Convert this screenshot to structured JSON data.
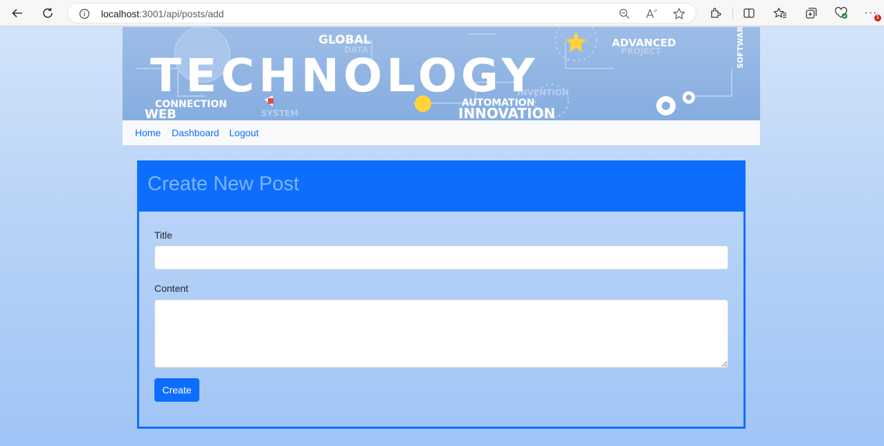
{
  "browser": {
    "url_host": "localhost",
    "url_rest": ":3001/api/posts/add",
    "notification_count": "1"
  },
  "banner": {
    "title": "TECHNOLOGY",
    "words": {
      "global": "GLOBAL",
      "advanced": "ADVANCED",
      "connection": "CONNECTION",
      "web": "WEB",
      "automation": "AUTOMATION",
      "innovation": "INNOVATION",
      "software": "SOFTWARE",
      "data": "DATA",
      "system": "SYSTEM",
      "invention": "INVENTION",
      "project": "PROJECT"
    }
  },
  "nav": {
    "home": "Home",
    "dashboard": "Dashboard",
    "logout": "Logout"
  },
  "form": {
    "heading": "Create New Post",
    "title_label": "Title",
    "title_value": "",
    "content_label": "Content",
    "content_value": "",
    "submit_label": "Create"
  },
  "colors": {
    "primary": "#0d6efd",
    "heading_text": "#7db3ff",
    "navbar_bg": "#f8f9fa"
  }
}
